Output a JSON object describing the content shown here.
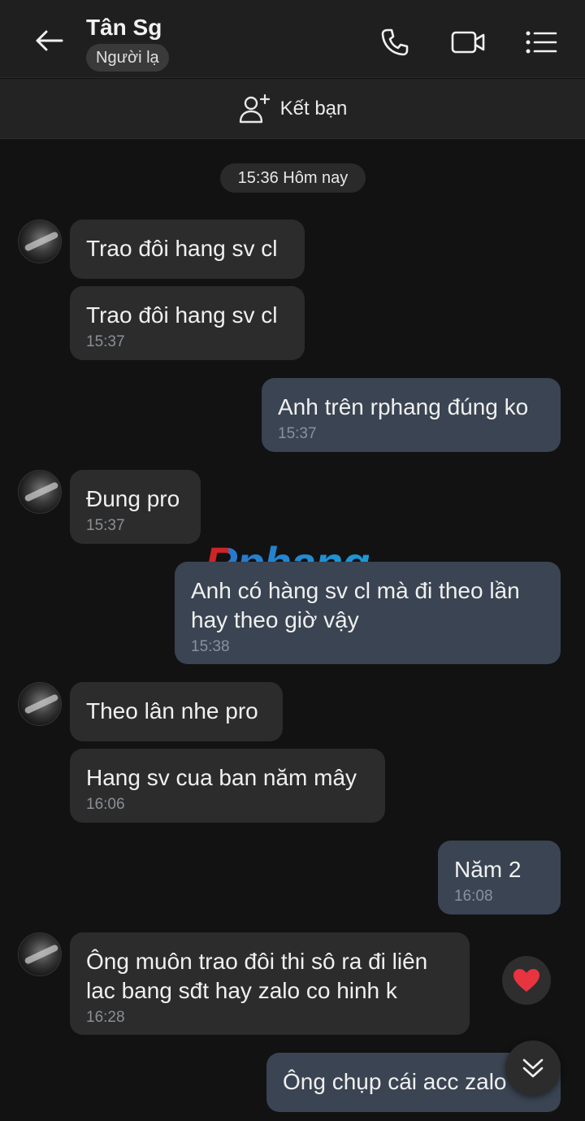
{
  "header": {
    "title": "Tân Sg",
    "badge": "Người lạ",
    "icons": [
      "back-arrow-icon",
      "phone-icon",
      "video-icon",
      "menu-list-icon"
    ]
  },
  "friend_bar": {
    "label": "Kết bạn",
    "icon": "add-friend-icon"
  },
  "date_separator": "15:36 Hôm nay",
  "watermark": "Rphang",
  "messages": [
    {
      "side": "in",
      "text": "Trao đôi hang sv cl",
      "time": ""
    },
    {
      "side": "in",
      "text": "Trao đôi hang sv cl",
      "time": "15:37"
    },
    {
      "side": "out",
      "text": "Anh trên rphang đúng ko",
      "time": "15:37"
    },
    {
      "side": "in",
      "text": "Đung pro",
      "time": "15:37"
    },
    {
      "side": "out",
      "text": "Anh có hàng sv cl mà đi theo lần\nhay theo giờ vậy",
      "time": "15:38"
    },
    {
      "side": "in",
      "text": "Theo lân nhe pro",
      "time": ""
    },
    {
      "side": "in",
      "text": "Hang sv cua ban năm mây",
      "time": "16:06"
    },
    {
      "side": "out",
      "text": "Năm 2",
      "time": "16:08"
    },
    {
      "side": "in",
      "text": "Ông muôn trao đôi thi sô ra đi liên\nlac bang sđt hay zalo co hinh k",
      "time": "16:28"
    },
    {
      "side": "out",
      "text": "Ông chụp cái acc zalo",
      "time": ""
    }
  ],
  "reaction": "heart-icon",
  "colors": {
    "incoming": "#2c2c2c",
    "outgoing": "#3a4452",
    "heart": "#e8343f"
  }
}
